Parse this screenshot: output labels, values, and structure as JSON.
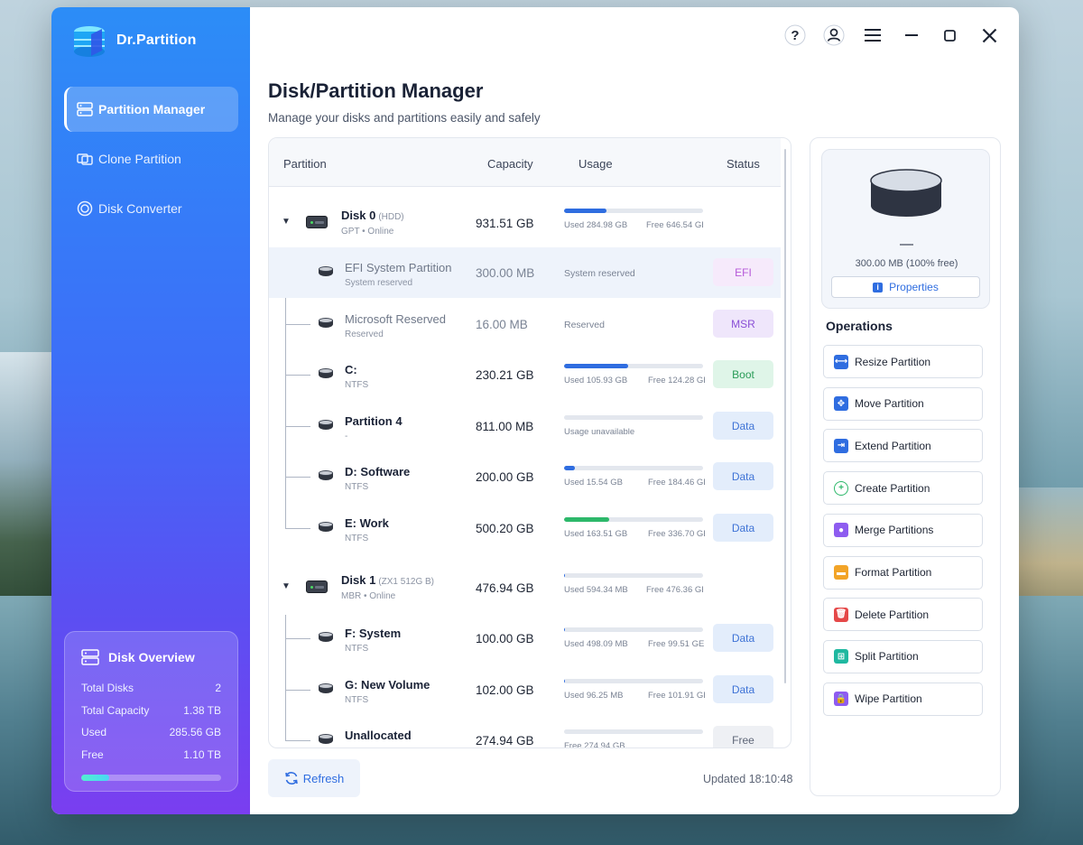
{
  "app": {
    "name": "Dr.Partition"
  },
  "nav": [
    {
      "label": "Partition Manager",
      "active": true
    },
    {
      "label": "Clone Partition",
      "active": false
    },
    {
      "label": "Disk Converter",
      "active": false
    }
  ],
  "overview": {
    "title": "Disk Overview",
    "rows": [
      {
        "label": "Total Disks",
        "value": "2"
      },
      {
        "label": "Total Capacity",
        "value": "1.38 TB"
      },
      {
        "label": "Used",
        "value": "285.56 GB"
      },
      {
        "label": "Free",
        "value": "1.10 TB"
      }
    ],
    "used_fraction": 0.2
  },
  "page": {
    "title": "Disk/Partition Manager",
    "subtitle": "Manage your disks and partitions easily and safely"
  },
  "table": {
    "headers": {
      "partition": "Partition",
      "capacity": "Capacity",
      "usage": "Usage",
      "status": "Status"
    }
  },
  "disks": [
    {
      "name": "Disk 0",
      "type": "(HDD)",
      "meta": "GPT  •  Online",
      "capacity": "931.51 GB",
      "usage_fraction": 0.306,
      "used": "Used 284.98 GB",
      "free": "Free 646.54 GE",
      "partitions": [
        {
          "name": "EFI System Partition",
          "fs": "System reserved",
          "capacity": "300.00 MB",
          "usage_text": "System reserved",
          "status": "EFI",
          "muted": true,
          "selected": true
        },
        {
          "name": "Microsoft Reserved",
          "fs": "Reserved",
          "capacity": "16.00 MB",
          "usage_text": "Reserved",
          "status": "MSR",
          "muted": true
        },
        {
          "name": "C:",
          "fs": "NTFS",
          "capacity": "230.21 GB",
          "usage_fraction": 0.46,
          "used": "Used 105.93 GB",
          "free": "Free 124.28 GE",
          "status": "Boot",
          "bar_color": "#2f6de0"
        },
        {
          "name": "Partition 4",
          "fs": "-",
          "capacity": "811.00 MB",
          "usage_fraction": 0,
          "usage_text": "Usage unavailable",
          "status": "Data"
        },
        {
          "name": "D: Software",
          "fs": "NTFS",
          "capacity": "200.00 GB",
          "usage_fraction": 0.077,
          "used": "Used 15.54 GB",
          "free": "Free 184.46 GE",
          "status": "Data",
          "bar_color": "#2f6de0"
        },
        {
          "name": "E: Work",
          "fs": "NTFS",
          "capacity": "500.20 GB",
          "usage_fraction": 0.327,
          "used": "Used 163.51 GB",
          "free": "Free 336.70 GE",
          "status": "Data",
          "bar_color": "#2db86a"
        }
      ]
    },
    {
      "name": "Disk 1",
      "type": "(ZX1 512G B)",
      "meta": "MBR  •  Online",
      "capacity": "476.94 GB",
      "usage_fraction": 0.001,
      "used": "Used 594.34 MB",
      "free": "Free 476.36 GE",
      "partitions": [
        {
          "name": "F: System",
          "fs": "NTFS",
          "capacity": "100.00 GB",
          "usage_fraction": 0.005,
          "used": "Used 498.09 MB",
          "free": "Free 99.51 GE",
          "status": "Data",
          "bar_color": "#2f6de0"
        },
        {
          "name": "G: New Volume",
          "fs": "NTFS",
          "capacity": "102.00 GB",
          "usage_fraction": 0.001,
          "used": "Used 96.25 MB",
          "free": "Free 101.91 GE",
          "status": "Data",
          "bar_color": "#2f6de0"
        },
        {
          "name": "Unallocated",
          "fs": "-",
          "capacity": "274.94 GB",
          "usage_fraction": 0,
          "used": "Free 274.94 GB",
          "free": "",
          "status": "Free"
        }
      ]
    }
  ],
  "footer": {
    "refresh": "Refresh",
    "updated": "Updated 18:10:48"
  },
  "properties": {
    "name": "—",
    "size": "300.00 MB (100% free)",
    "button": "Properties"
  },
  "operations": {
    "title": "Operations",
    "items": [
      {
        "label": "Resize Partition",
        "icon": "resize-icon",
        "color": "#2f6de0"
      },
      {
        "label": "Move Partition",
        "icon": "move-icon",
        "color": "#2f6de0"
      },
      {
        "label": "Extend Partition",
        "icon": "extend-icon",
        "color": "#2f6de0"
      },
      {
        "label": "Create Partition",
        "icon": "create-icon",
        "color": "#2db86a"
      },
      {
        "label": "Merge Partitions",
        "icon": "merge-icon",
        "color": "#8e5cf0"
      },
      {
        "label": "Format Partition",
        "icon": "folder-icon",
        "color": "#f2a428"
      },
      {
        "label": "Delete Partition",
        "icon": "trash-icon",
        "color": "#e54848"
      },
      {
        "label": "Split Partition",
        "icon": "split-icon",
        "color": "#1fb8a0"
      },
      {
        "label": "Wipe Partition",
        "icon": "lock-icon",
        "color": "#8e5cf0"
      }
    ]
  },
  "status_colors": {
    "EFI": {
      "bg": "#f6eafb",
      "fg": "#b65ad8"
    },
    "MSR": {
      "bg": "#efe6fb",
      "fg": "#8a4fd6"
    },
    "Boot": {
      "bg": "#dff5e8",
      "fg": "#2a9c58"
    },
    "Data": {
      "bg": "#e3edfb",
      "fg": "#3d72d6"
    },
    "Free": {
      "bg": "#eef0f4",
      "fg": "#5e6677"
    }
  }
}
